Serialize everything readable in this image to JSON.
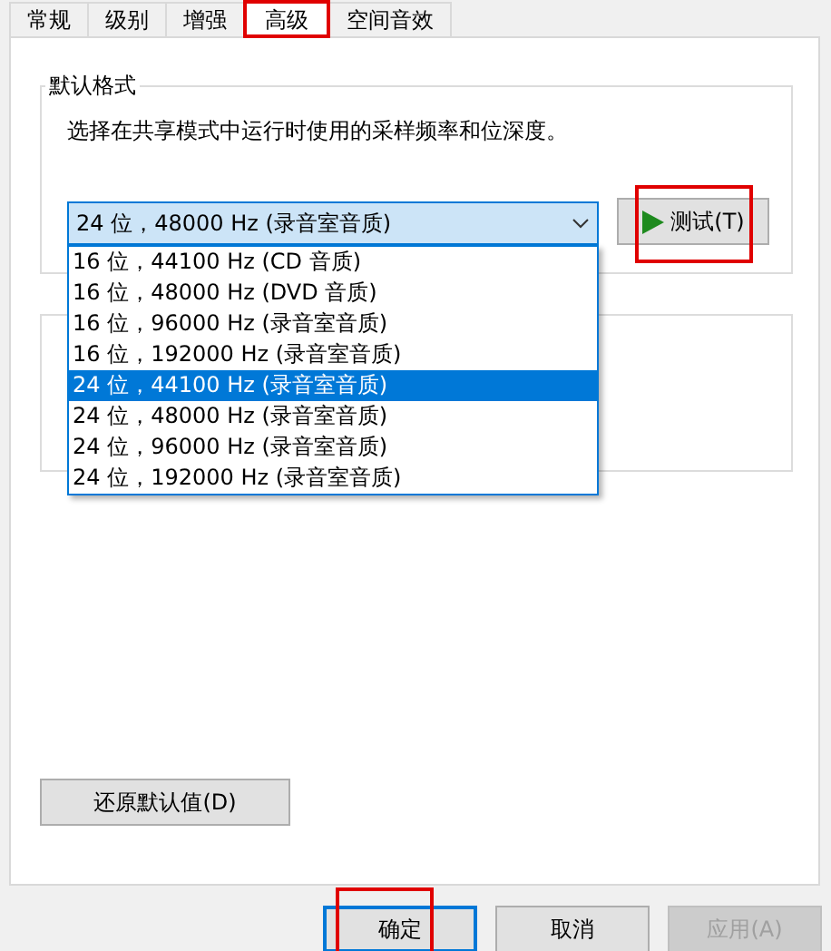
{
  "tabs": [
    {
      "label": "常规",
      "selected": false,
      "highlighted": false
    },
    {
      "label": "级别",
      "selected": false,
      "highlighted": false
    },
    {
      "label": "增强",
      "selected": false,
      "highlighted": false
    },
    {
      "label": "高级",
      "selected": true,
      "highlighted": true
    },
    {
      "label": "空间音效",
      "selected": false,
      "highlighted": false
    }
  ],
  "default_format": {
    "title": "默认格式",
    "description": "选择在共享模式中运行时使用的采样频率和位深度。",
    "format_select": {
      "value": "24 位，48000 Hz (录音室音质)",
      "expanded": true
    },
    "options": [
      {
        "label": "16 位，44100 Hz (CD 音质)",
        "selected": false
      },
      {
        "label": "16 位，48000 Hz (DVD 音质)",
        "selected": false
      },
      {
        "label": "16 位，96000 Hz (录音室音质)",
        "selected": false
      },
      {
        "label": "16 位，192000 Hz (录音室音质)",
        "selected": false
      },
      {
        "label": "24 位，44100 Hz (录音室音质)",
        "selected": true
      },
      {
        "label": "24 位，48000 Hz (录音室音质)",
        "selected": false
      },
      {
        "label": "24 位，96000 Hz (录音室音质)",
        "selected": false
      },
      {
        "label": "24 位，192000 Hz (录音室音质)",
        "selected": false
      }
    ],
    "test_button": {
      "label": "测试(T)",
      "highlighted": true
    }
  },
  "restore_button": {
    "label": "还原默认值(D)"
  },
  "buttons": [
    {
      "label": "确定",
      "focused": true,
      "disabled": false,
      "highlighted": true
    },
    {
      "label": "取消",
      "focused": false,
      "disabled": false,
      "highlighted": false
    },
    {
      "label": "应用(A)",
      "focused": false,
      "disabled": true,
      "highlighted": false
    }
  ]
}
